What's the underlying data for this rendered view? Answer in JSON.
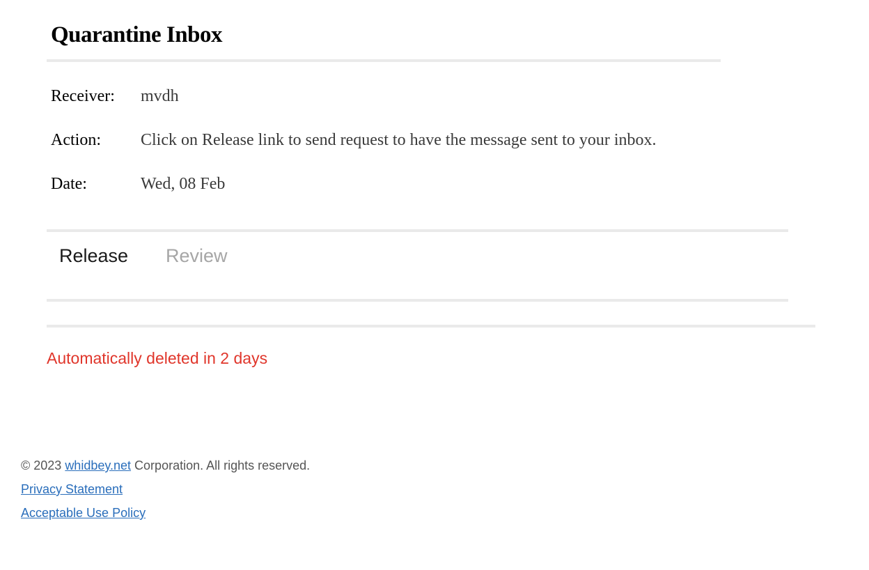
{
  "header": {
    "title": "Quarantine Inbox"
  },
  "details": {
    "receiver_label": "Receiver:",
    "receiver_value": "mvdh",
    "action_label": "Action:",
    "action_value": "Click on Release link to send request to have the message sent to your inbox.",
    "date_label": "Date:",
    "date_value": "Wed, 08 Feb"
  },
  "actions": {
    "release_label": "Release",
    "review_label": "Review"
  },
  "expiry": {
    "text": "Automatically deleted in 2 days",
    "color": "#e0362b"
  },
  "footer": {
    "copyright_prefix": "© 2023 ",
    "company_link": "whidbey.net",
    "copyright_suffix": " Corporation. All rights reserved.",
    "privacy_link": "Privacy Statement",
    "aup_link": "Acceptable Use Policy",
    "link_color": "#2a6ebb"
  }
}
